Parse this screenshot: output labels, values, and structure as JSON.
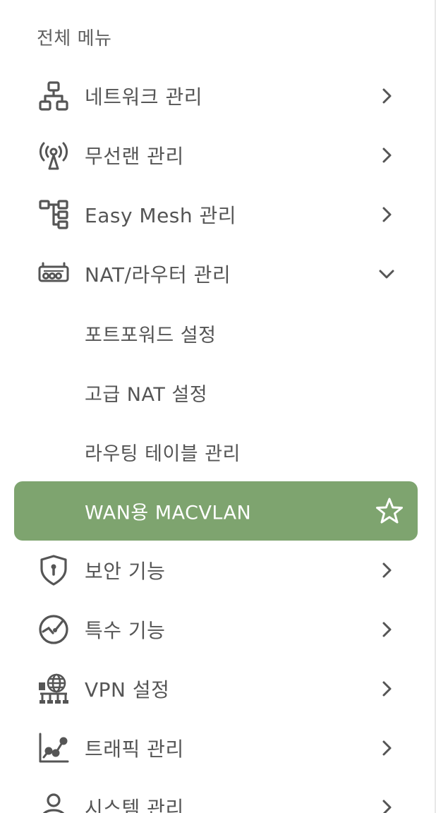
{
  "menu_title": "전체 메뉴",
  "items": [
    {
      "label": "네트워크 관리",
      "icon": "network-icon",
      "expanded": false
    },
    {
      "label": "무선랜 관리",
      "icon": "wireless-antenna-icon",
      "expanded": false
    },
    {
      "label": "Easy Mesh 관리",
      "icon": "mesh-tree-icon",
      "expanded": false
    },
    {
      "label": "NAT/라우터 관리",
      "icon": "router-icon",
      "expanded": true,
      "children": [
        {
          "label": "포트포워드 설정"
        },
        {
          "label": "고급 NAT 설정"
        },
        {
          "label": "라우팅 테이블 관리"
        },
        {
          "label": "WAN용 MACVLAN",
          "active": true,
          "favorite_icon": "star-outline-icon"
        }
      ]
    },
    {
      "label": "보안 기능",
      "icon": "shield-lock-icon",
      "expanded": false
    },
    {
      "label": "특수 기능",
      "icon": "special-function-icon",
      "expanded": false
    },
    {
      "label": "VPN 설정",
      "icon": "vpn-globe-icon",
      "expanded": false
    },
    {
      "label": "트래픽 관리",
      "icon": "traffic-chart-icon",
      "expanded": false
    },
    {
      "label": "시스템 관리",
      "icon": "system-user-icon",
      "expanded": false
    }
  ],
  "colors": {
    "active_bg": "#7ea46f",
    "text": "#555555",
    "icon": "#555555"
  }
}
